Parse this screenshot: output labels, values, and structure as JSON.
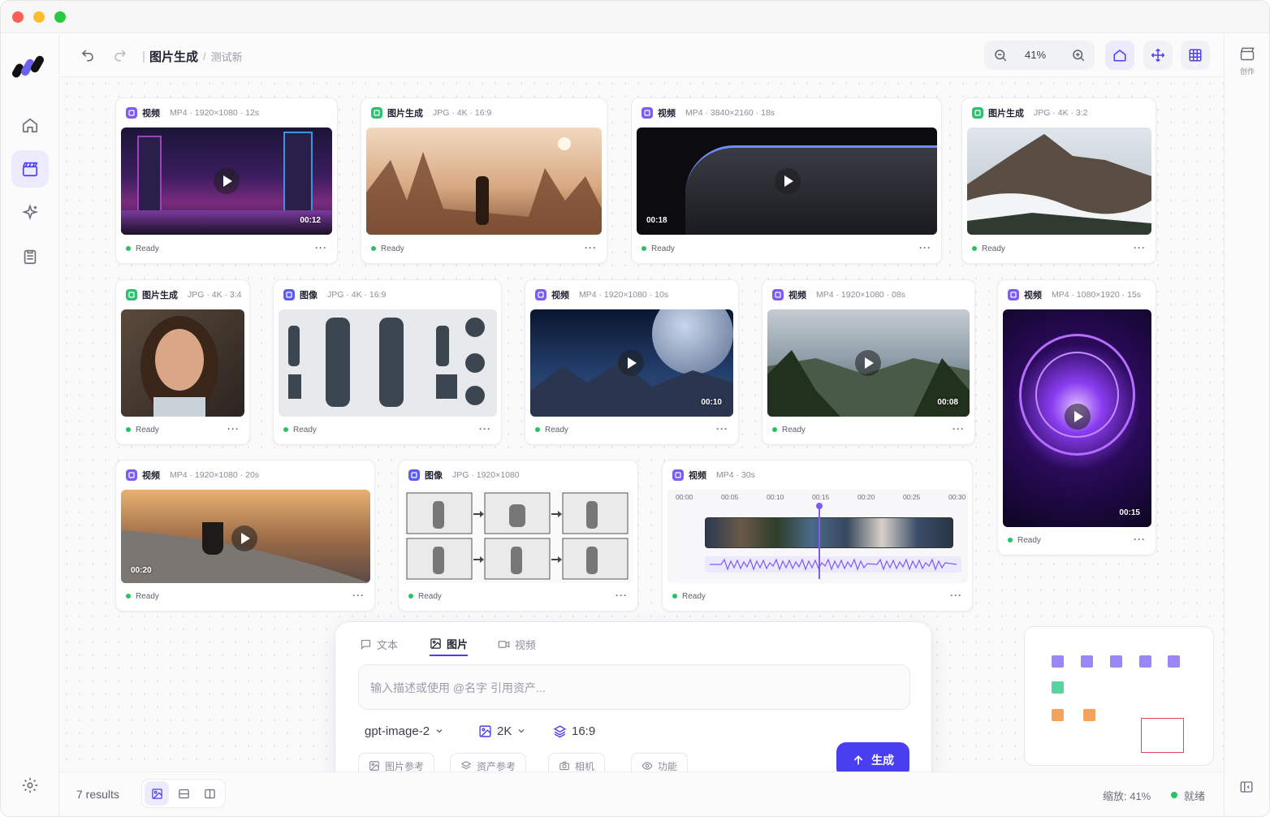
{
  "breadcrumb": {
    "title": "图片生成",
    "separator": "/",
    "sub": "测试新"
  },
  "zoom": {
    "value": "41%"
  },
  "rightbar": {
    "label": "创作"
  },
  "colors": {
    "accent": "#4a3ff0",
    "video": "#7c5cf5",
    "gen": "#2fbf71",
    "ready": "#22c55e"
  },
  "cards": [
    {
      "type": "视频",
      "meta": "MP4 · 1920×1080 · 12s",
      "duration": "00:12",
      "status": "Ready"
    },
    {
      "type": "图片生成",
      "meta": "JPG · 4K · 16:9",
      "status": "Ready"
    },
    {
      "type": "视频",
      "meta": "MP4 · 3840×2160 · 18s",
      "duration": "00:18",
      "status": "Ready"
    },
    {
      "type": "图片生成",
      "meta": "JPG · 4K · 3:2",
      "status": "Ready"
    },
    {
      "type": "图片生成",
      "meta": "JPG · 4K · 3:4",
      "status": "Ready"
    },
    {
      "type": "图像",
      "meta": "JPG · 4K · 16:9",
      "status": "Ready"
    },
    {
      "type": "视频",
      "meta": "MP4 · 1920×1080 · 10s",
      "duration": "00:10",
      "status": "Ready"
    },
    {
      "type": "视频",
      "meta": "MP4 · 1920×1080 · 08s",
      "duration": "00:08",
      "status": "Ready"
    },
    {
      "type": "视频",
      "meta": "MP4 · 1080×1920 · 15s",
      "duration": "00:15",
      "status": "Ready"
    },
    {
      "type": "视频",
      "meta": "MP4 · 1920×1080 · 20s",
      "duration": "00:20",
      "status": "Ready"
    },
    {
      "type": "图像",
      "meta": "JPG · 1920×1080",
      "status": "Ready"
    },
    {
      "type": "视频",
      "meta": "MP4 · 30s",
      "status": "Ready"
    }
  ],
  "timeline": {
    "ticks": [
      "00:00",
      "00:05",
      "00:10",
      "00:15",
      "00:20",
      "00:25",
      "00:30"
    ]
  },
  "composer": {
    "tabs": [
      "文本",
      "图片",
      "视频"
    ],
    "placeholder": "输入描述或使用 @名字 引用资产...",
    "model": "gpt-image-2",
    "resolution": "2K",
    "ratio": "16:9",
    "chips": [
      "图片参考",
      "资产参考",
      "相机",
      "功能"
    ],
    "generate": "生成"
  },
  "footer": {
    "results": "7 results",
    "zoom_label": "缩放: 41%",
    "status": "就绪"
  }
}
